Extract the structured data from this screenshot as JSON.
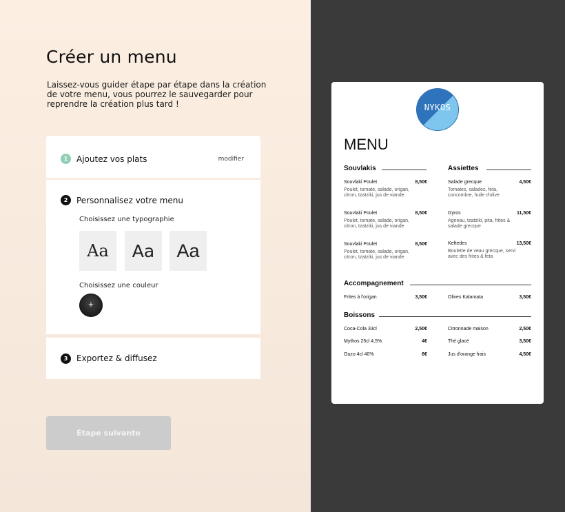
{
  "page": {
    "title": "Créer un menu",
    "intro": "Laissez-vous guider étape par étape dans la création de votre menu, vous pourrez le sauvegarder pour reprendre la création plus tard !"
  },
  "steps": [
    {
      "number": "1",
      "label": "Ajoutez vos plats",
      "action": "modifier",
      "status": "done"
    },
    {
      "number": "2",
      "label": "Personnalisez votre menu",
      "status": "active",
      "typography_label": "Choisissez une typographie",
      "typography_options": [
        "Aa",
        "Aa",
        "Aa"
      ],
      "color_label": "Choisissez une couleur",
      "color_add": "+"
    },
    {
      "number": "3",
      "label": "Exportez & diffusez",
      "status": "pending"
    }
  ],
  "next_button": "Étape suivante",
  "colors": {
    "accent_done": "#8fcfb4",
    "active": "#111111",
    "button_disabled": "#cccccc",
    "panel_dark": "#3a3a3a",
    "bg_left": "#fcefe2"
  },
  "preview": {
    "logo_text": "NYKOS",
    "menu_title": "MENU",
    "sections": {
      "souvlakis": {
        "title": "Souvlakis",
        "items": [
          {
            "name": "Souvlaki Poulet",
            "price": "8,50€",
            "desc": "Poulet, tomate, salade, origan, citron, tzatziki, jus de viande"
          },
          {
            "name": "Souvlaki Poulet",
            "price": "8,50€",
            "desc": "Poulet, tomate, salade, origan, citron, tzatziki, jus de viande"
          },
          {
            "name": "Souvlaki Poulet",
            "price": "8,50€",
            "desc": "Poulet, tomate, salade, origan, citron, tzatziki, jus de viande"
          }
        ]
      },
      "assiettes": {
        "title": "Assiettes",
        "items": [
          {
            "name": "Salade grecque",
            "price": "4,50€",
            "desc": "Tomates, salades, feta, concombre, huile d'olive"
          },
          {
            "name": "Gyros",
            "price": "11,50€",
            "desc": "Agneau, tzatziki, pita, frites & salade grecque"
          },
          {
            "name": "Keftedes",
            "price": "13,50€",
            "desc": "Boulette de veau grecque, servi avec des frites & feta"
          }
        ]
      },
      "accompagnement": {
        "title": "Accompagnement",
        "items": [
          {
            "name": "Frites à l'origan",
            "price": "3,50€"
          },
          {
            "name": "Olives Kalamata",
            "price": "3,50€"
          }
        ]
      },
      "boissons": {
        "title": "Boissons",
        "items": [
          {
            "name": "Coca-Cola 33cl",
            "price": "2,50€"
          },
          {
            "name": "Mythos 25cl 4,5%",
            "price": "4€"
          },
          {
            "name": "Ouzo 4cl 40%",
            "price": "8€"
          },
          {
            "name": "Citronnade maison",
            "price": "2,50€"
          },
          {
            "name": "Thé glacé",
            "price": "3,50€"
          },
          {
            "name": "Jus d'orange frais",
            "price": "4,50€"
          }
        ]
      }
    }
  }
}
